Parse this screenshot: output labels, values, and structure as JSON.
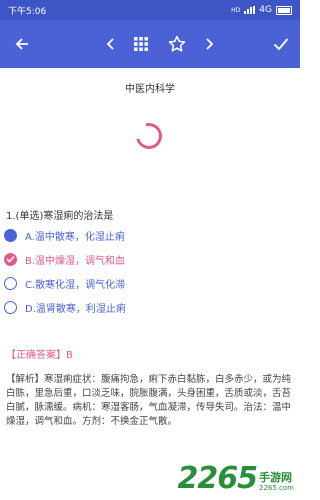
{
  "status_bar": {
    "time": "下午5:06",
    "network": "4G",
    "signal_label": "HD"
  },
  "toolbar": {
    "back_icon": "arrow-left-icon",
    "prev_icon": "chevron-left-icon",
    "grid_icon": "grid-icon",
    "star_icon": "star-icon",
    "next_icon": "chevron-right-icon",
    "confirm_icon": "check-icon"
  },
  "title": "中医内科学",
  "question": {
    "text": "1.(单选)寒湿痢的治法是",
    "options": [
      {
        "label": "A.温中散寒，化湿止痢"
      },
      {
        "label": "B.温中燥湿，调气和血"
      },
      {
        "label": "C.散寒化湿，调气化滞"
      },
      {
        "label": "D.温肾散寒，利湿止痢"
      }
    ]
  },
  "answer": "【正确答案】B",
  "analysis": "【解析】寒湿痢症状：腹痛拘急，痢下赤白黏胨，白多赤少，或为纯白胨，里急后重，口淡乏味，脘胀腹满，头身困重，舌质或淡，舌苔白腻，脉濡缓。病机：寒湿客肠，气血凝滞，传导失司。治法：温中燥湿，调气和血。方剂：不换金正气散。",
  "watermark": {
    "number": "2265",
    "brand": "手游网",
    "url": "2265.com"
  },
  "colors": {
    "primary": "#4a62d6",
    "accent": "#e05a8c"
  }
}
